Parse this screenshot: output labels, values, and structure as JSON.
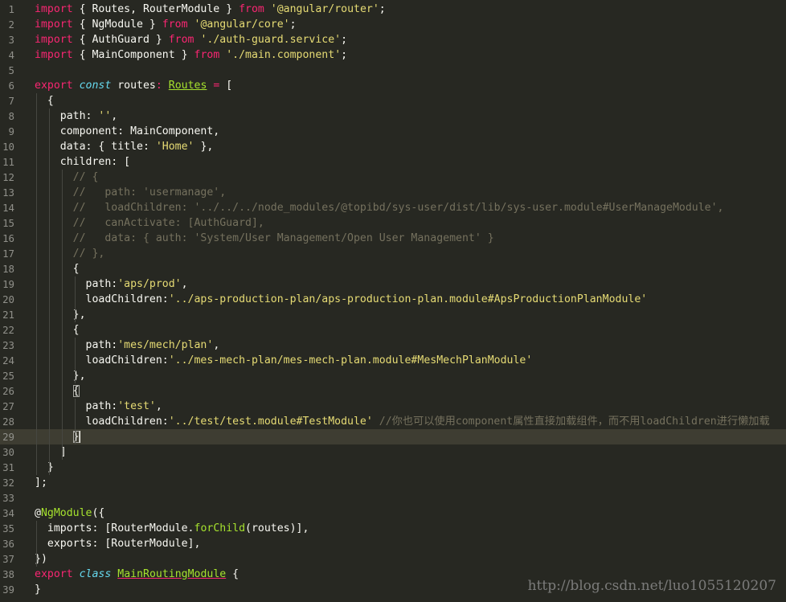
{
  "editor": {
    "theme_colors": {
      "background": "#272822",
      "keyword": "#f92672",
      "string": "#e6db74",
      "comment": "#75715e",
      "function": "#a6e22e",
      "storage": "#66d9ef"
    },
    "active_line": 29,
    "lines": [
      {
        "n": "1",
        "code": "import { Routes, RouterModule } from '@angular/router';"
      },
      {
        "n": "2",
        "code": "import { NgModule } from '@angular/core';"
      },
      {
        "n": "3",
        "code": "import { AuthGuard } from './auth-guard.service';"
      },
      {
        "n": "4",
        "code": "import { MainComponent } from './main.component';"
      },
      {
        "n": "5",
        "code": ""
      },
      {
        "n": "6",
        "code": "export const routes: Routes = ["
      },
      {
        "n": "7",
        "code": "  {"
      },
      {
        "n": "8",
        "code": "    path: '',"
      },
      {
        "n": "9",
        "code": "    component: MainComponent,"
      },
      {
        "n": "10",
        "code": "    data: { title: 'Home' },"
      },
      {
        "n": "11",
        "code": "    children: ["
      },
      {
        "n": "12",
        "code": "      // {"
      },
      {
        "n": "13",
        "code": "      //   path: 'usermanage',"
      },
      {
        "n": "14",
        "code": "      //   loadChildren: '../../../node_modules/@topibd/sys-user/dist/lib/sys-user.module#UserManageModule',"
      },
      {
        "n": "15",
        "code": "      //   canActivate: [AuthGuard],"
      },
      {
        "n": "16",
        "code": "      //   data: { auth: 'System/User Management/Open User Management' }"
      },
      {
        "n": "17",
        "code": "      // },"
      },
      {
        "n": "18",
        "code": "      {"
      },
      {
        "n": "19",
        "code": "        path:'aps/prod',"
      },
      {
        "n": "20",
        "code": "        loadChildren:'../aps-production-plan/aps-production-plan.module#ApsProductionPlanModule'"
      },
      {
        "n": "21",
        "code": "      },"
      },
      {
        "n": "22",
        "code": "      {"
      },
      {
        "n": "23",
        "code": "        path:'mes/mech/plan',"
      },
      {
        "n": "24",
        "code": "        loadChildren:'../mes-mech-plan/mes-mech-plan.module#MesMechPlanModule'"
      },
      {
        "n": "25",
        "code": "      },"
      },
      {
        "n": "26",
        "code": "      {"
      },
      {
        "n": "27",
        "code": "        path:'test',"
      },
      {
        "n": "28",
        "code": "        loadChildren:'../test/test.module#TestModule' //你也可以使用component属性直接加载组件，而不用loadChildren进行懒加载"
      },
      {
        "n": "29",
        "code": "      }"
      },
      {
        "n": "30",
        "code": "    ]"
      },
      {
        "n": "31",
        "code": "  }"
      },
      {
        "n": "32",
        "code": "];"
      },
      {
        "n": "33",
        "code": ""
      },
      {
        "n": "34",
        "code": "@NgModule({"
      },
      {
        "n": "35",
        "code": "  imports: [RouterModule.forChild(routes)],"
      },
      {
        "n": "36",
        "code": "  exports: [RouterModule],"
      },
      {
        "n": "37",
        "code": "})"
      },
      {
        "n": "38",
        "code": "export class MainRoutingModule {"
      },
      {
        "n": "39",
        "code": "}"
      }
    ]
  },
  "watermark": "http://blog.csdn.net/luo1055120207"
}
